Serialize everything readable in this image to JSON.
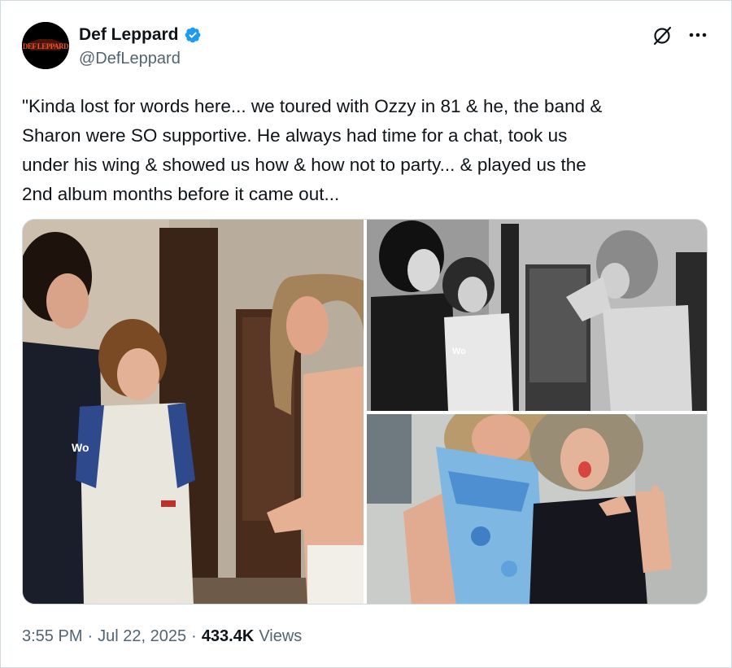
{
  "author": {
    "display_name": "Def Leppard",
    "handle": "@DefLeppard",
    "avatar_logo_text": "DEF LEPPARD",
    "verified": true,
    "verified_color": "#1d9bf0"
  },
  "tweet": {
    "text": "\"Kinda lost for words here... we toured with Ozzy in 81 & he, the band &\nSharon were SO supportive. He always had time for a chat, took us\nunder his wing & showed us how & how not to party... & played us the\n2nd album months before it came out..."
  },
  "media": {
    "photos": [
      {
        "name": "color-backstage-photo",
        "shirt_text": "Wo"
      },
      {
        "name": "bw-backstage-photo",
        "shirt_text": "Wo"
      },
      {
        "name": "color-tongue-out-photo"
      }
    ]
  },
  "footer": {
    "time": "3:55 PM",
    "separator": "·",
    "date": "Jul 22, 2025",
    "views_count": "433.4K",
    "views_label": "Views"
  },
  "icons": {
    "grok": "grok-icon",
    "more": "more-options-icon",
    "verified": "verified-badge-icon"
  },
  "colors": {
    "text_primary": "#0f1419",
    "text_secondary": "#536471",
    "border": "#cfd9de"
  }
}
